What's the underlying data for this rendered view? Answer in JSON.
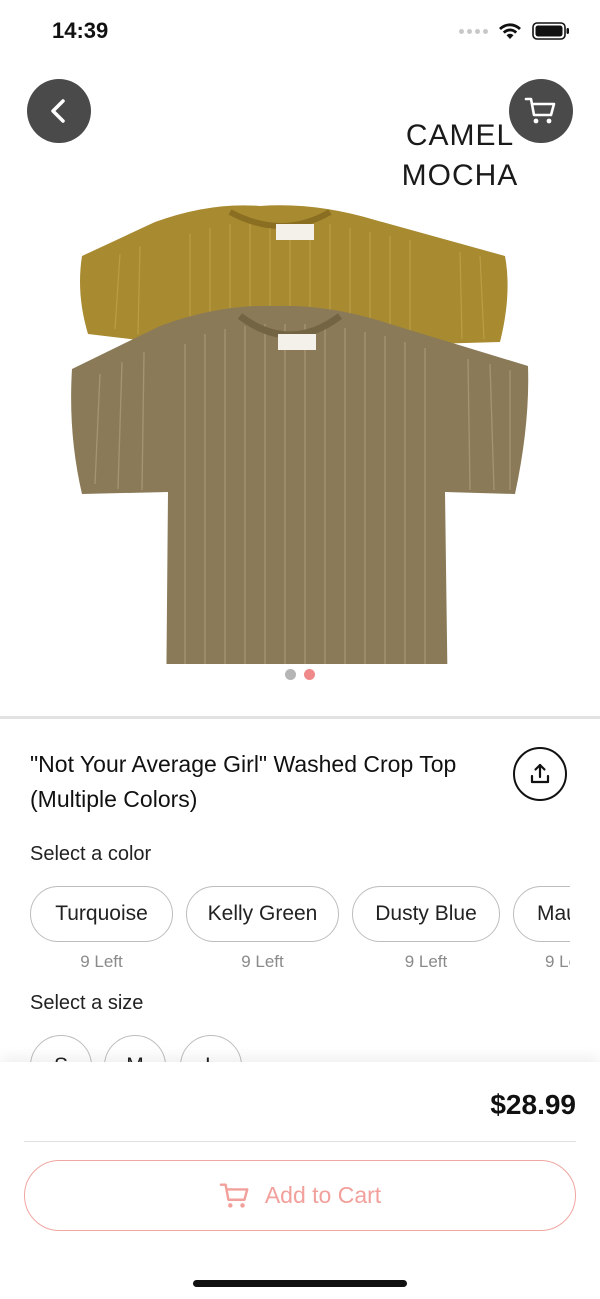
{
  "status_bar": {
    "time": "14:39"
  },
  "hero": {
    "overlay_text": [
      "CAMEL",
      "MOCHA"
    ],
    "image_pages": 2,
    "active_page": 2,
    "colors": {
      "dot_inactive": "#b5b5b5",
      "dot_active": "#f08a8a"
    }
  },
  "product": {
    "title": "\"Not Your Average Girl\" Washed Crop Top (Multiple Colors)",
    "price": "$28.99"
  },
  "color_select": {
    "label": "Select a color",
    "options": [
      {
        "name": "Turquoise",
        "stock": "9 Left"
      },
      {
        "name": "Kelly Green",
        "stock": "9 Left"
      },
      {
        "name": "Dusty Blue",
        "stock": "9 Left"
      },
      {
        "name": "Mau",
        "stock": "9 Le"
      }
    ]
  },
  "size_select": {
    "label": "Select a size",
    "options": [
      "S",
      "M",
      "L"
    ]
  },
  "actions": {
    "add_to_cart": "Add to Cart"
  },
  "icons": {
    "back": "chevron-left-icon",
    "cart": "cart-icon",
    "share": "share-icon",
    "add_to_cart": "cart-icon"
  },
  "theme": {
    "accent": "#f2a09b",
    "button_dark": "#4a4a4a"
  }
}
